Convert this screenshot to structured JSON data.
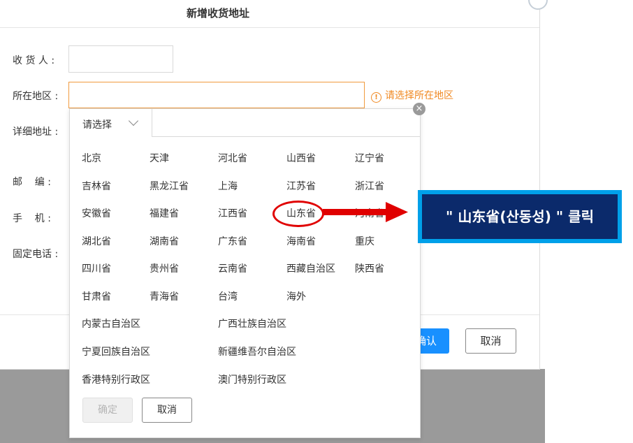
{
  "dialog": {
    "title": "新增收货地址",
    "fields": {
      "recipient_label": "收 货 人 :",
      "region_label": "所在地区 :",
      "detail_label": "详细地址 :",
      "postcode_label": "邮    编 :",
      "phone_label": "手    机 :",
      "landline_label": "固定电话 :"
    },
    "region_warning": "请选择所在地区",
    "warning_icon": "!",
    "confirm_label": "确认",
    "cancel_label": "取消"
  },
  "region_picker": {
    "tab_label": "请选择",
    "close_glyph": "×",
    "regions": [
      "北京",
      "天津",
      "河北省",
      "山西省",
      "辽宁省",
      "吉林省",
      "黑龙江省",
      "上海",
      "江苏省",
      "浙江省",
      "安徽省",
      "福建省",
      "江西省",
      "山东省",
      "河南省",
      "湖北省",
      "湖南省",
      "广东省",
      "海南省",
      "重庆",
      "四川省",
      "贵州省",
      "云南省",
      "西藏自治区",
      "陕西省",
      "甘肃省",
      "青海省",
      "台湾",
      "海外",
      "内蒙古自治区",
      "广西壮族自治区",
      "宁夏回族自治区",
      "新疆维吾尔自治区",
      "香港特别行政区",
      "澳门特别行政区"
    ],
    "confirm_label": "确定",
    "cancel_label": "取消"
  },
  "annotation": {
    "callout_text": "\" 山东省(산동성) \" 클릭",
    "highlight_color": "#e00000",
    "callout_bg": "#0b2a6b",
    "callout_border": "#00a0e9"
  }
}
